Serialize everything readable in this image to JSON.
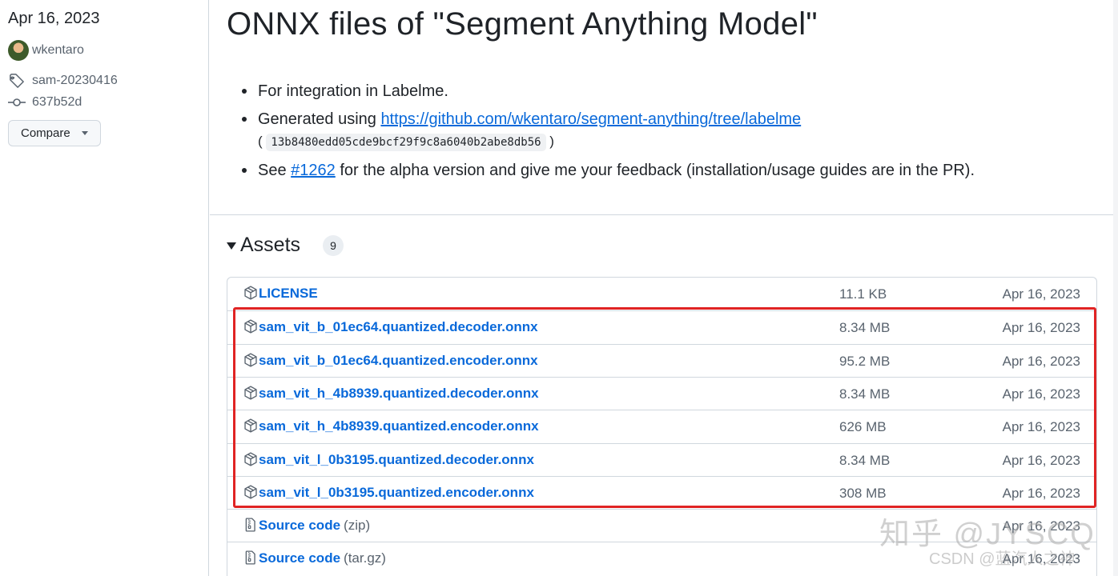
{
  "sidebar": {
    "date": "Apr 16, 2023",
    "author": "wkentaro",
    "tag": "sam-20230416",
    "commit": "637b52d",
    "compare_label": "Compare"
  },
  "release": {
    "title": "ONNX files of \"Segment Anything Model\"",
    "bullet1": "For integration in Labelme.",
    "bullet2_prefix": "Generated using ",
    "bullet2_link": "https://github.com/wkentaro/segment-anything/tree/labelme",
    "bullet2_open": "(",
    "bullet2_hash": "13b8480edd05cde9bcf29f9c8a6040b2abe8db56",
    "bullet2_close": ")",
    "bullet3_prefix": "See ",
    "bullet3_link": "#1262",
    "bullet3_suffix": " for the alpha version and give me your feedback (installation/usage guides are in the PR)."
  },
  "assets": {
    "title": "Assets",
    "count": "9",
    "rows": [
      {
        "name": "LICENSE",
        "suffix": "",
        "size": "11.1 KB",
        "date": "Apr 16, 2023",
        "icon": "package-icon"
      },
      {
        "name": "sam_vit_b_01ec64.quantized.decoder.onnx",
        "suffix": "",
        "size": "8.34 MB",
        "date": "Apr 16, 2023",
        "icon": "package-icon"
      },
      {
        "name": "sam_vit_b_01ec64.quantized.encoder.onnx",
        "suffix": "",
        "size": "95.2 MB",
        "date": "Apr 16, 2023",
        "icon": "package-icon"
      },
      {
        "name": "sam_vit_h_4b8939.quantized.decoder.onnx",
        "suffix": "",
        "size": "8.34 MB",
        "date": "Apr 16, 2023",
        "icon": "package-icon"
      },
      {
        "name": "sam_vit_h_4b8939.quantized.encoder.onnx",
        "suffix": "",
        "size": "626 MB",
        "date": "Apr 16, 2023",
        "icon": "package-icon"
      },
      {
        "name": "sam_vit_l_0b3195.quantized.decoder.onnx",
        "suffix": "",
        "size": "8.34 MB",
        "date": "Apr 16, 2023",
        "icon": "package-icon"
      },
      {
        "name": "sam_vit_l_0b3195.quantized.encoder.onnx",
        "suffix": "",
        "size": "308 MB",
        "date": "Apr 16, 2023",
        "icon": "package-icon"
      },
      {
        "name": "Source code",
        "suffix": "(zip)",
        "size": "",
        "date": "Apr 16, 2023",
        "icon": "file-zip-icon"
      },
      {
        "name": "Source code",
        "suffix": "(tar.gz)",
        "size": "",
        "date": "Apr 16, 2023",
        "icon": "file-zip-icon"
      }
    ]
  },
  "watermark": {
    "line1": "知乎 @JYSCQ",
    "line2": "CSDN @蓝汽人之神"
  },
  "colors": {
    "link": "#0969da",
    "highlight": "#e02424",
    "muted": "#59636e",
    "border": "#d0d7de"
  }
}
